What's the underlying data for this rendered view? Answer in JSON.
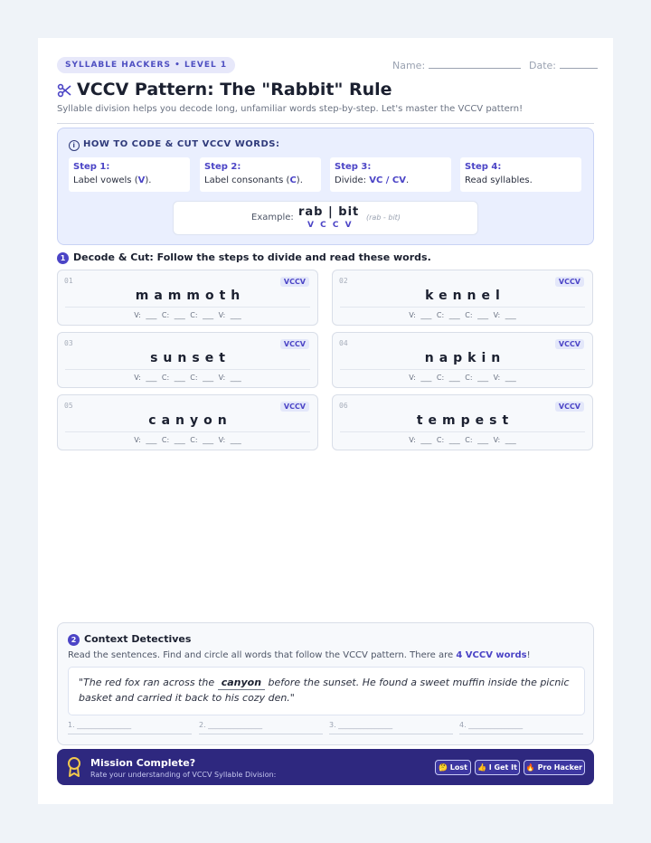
{
  "header": {
    "badge": "SYLLABLE HACKERS • LEVEL 1",
    "name_label": "Name:",
    "date_label": "Date:",
    "title": "VCCV Pattern: The \"Rabbit\" Rule",
    "subtitle": "Syllable division helps you decode long, unfamiliar words step-by-step. Let's master the VCCV pattern!"
  },
  "howto": {
    "heading": "HOW TO CODE & CUT VCCV WORDS:",
    "steps": [
      {
        "label": "Step 1:",
        "pre": "Label vowels (",
        "key": "V",
        "post": ")."
      },
      {
        "label": "Step 2:",
        "pre": "Label consonants (",
        "key": "C",
        "post": ")."
      },
      {
        "label": "Step 3:",
        "pre": "Divide: ",
        "key": "VC / CV",
        "post": "."
      },
      {
        "label": "Step 4:",
        "pre": "Read syllables.",
        "key": "",
        "post": ""
      }
    ],
    "example": {
      "label": "Example:",
      "word": "rab | bit",
      "code": "V C C V",
      "note": "(rab - bit)"
    }
  },
  "section1": {
    "number": "1",
    "title": "Decode & Cut: Follow the steps to divide and read these words.",
    "codes": "V: ___   C: ___   C: ___   V: ___",
    "words": [
      {
        "num": "01",
        "tag": "VCCV",
        "word": "mammoth"
      },
      {
        "num": "02",
        "tag": "VCCV",
        "word": "kennel"
      },
      {
        "num": "03",
        "tag": "VCCV",
        "word": "sunset"
      },
      {
        "num": "04",
        "tag": "VCCV",
        "word": "napkin"
      },
      {
        "num": "05",
        "tag": "VCCV",
        "word": "canyon"
      },
      {
        "num": "06",
        "tag": "VCCV",
        "word": "tempest"
      }
    ]
  },
  "section2": {
    "number": "2",
    "title": "Context Detectives",
    "instr_pre": "Read the sentences. Find and circle all words that follow the VCCV pattern. There are ",
    "instr_count": "4 VCCV words",
    "instr_post": "!",
    "passage_pre": "\"The red fox ran across the",
    "passage_highlight": "canyon",
    "passage_post": "before the sunset. He found a sweet muffin inside the picnic basket and carried it back to his cozy den.\"",
    "answers": [
      "1. _______________",
      "2. _______________",
      "3. _______________",
      "4. _______________"
    ]
  },
  "mission": {
    "title": "Mission Complete?",
    "subtitle": "Rate your understanding of VCCV Syllable Division:",
    "buttons": [
      "🤔 Lost",
      "👍 I Get It",
      "🔥 Pro Hacker"
    ]
  },
  "colors": {
    "accent": "#4b44c6",
    "banner": "#2e287f",
    "panel": "#eaeffe"
  }
}
